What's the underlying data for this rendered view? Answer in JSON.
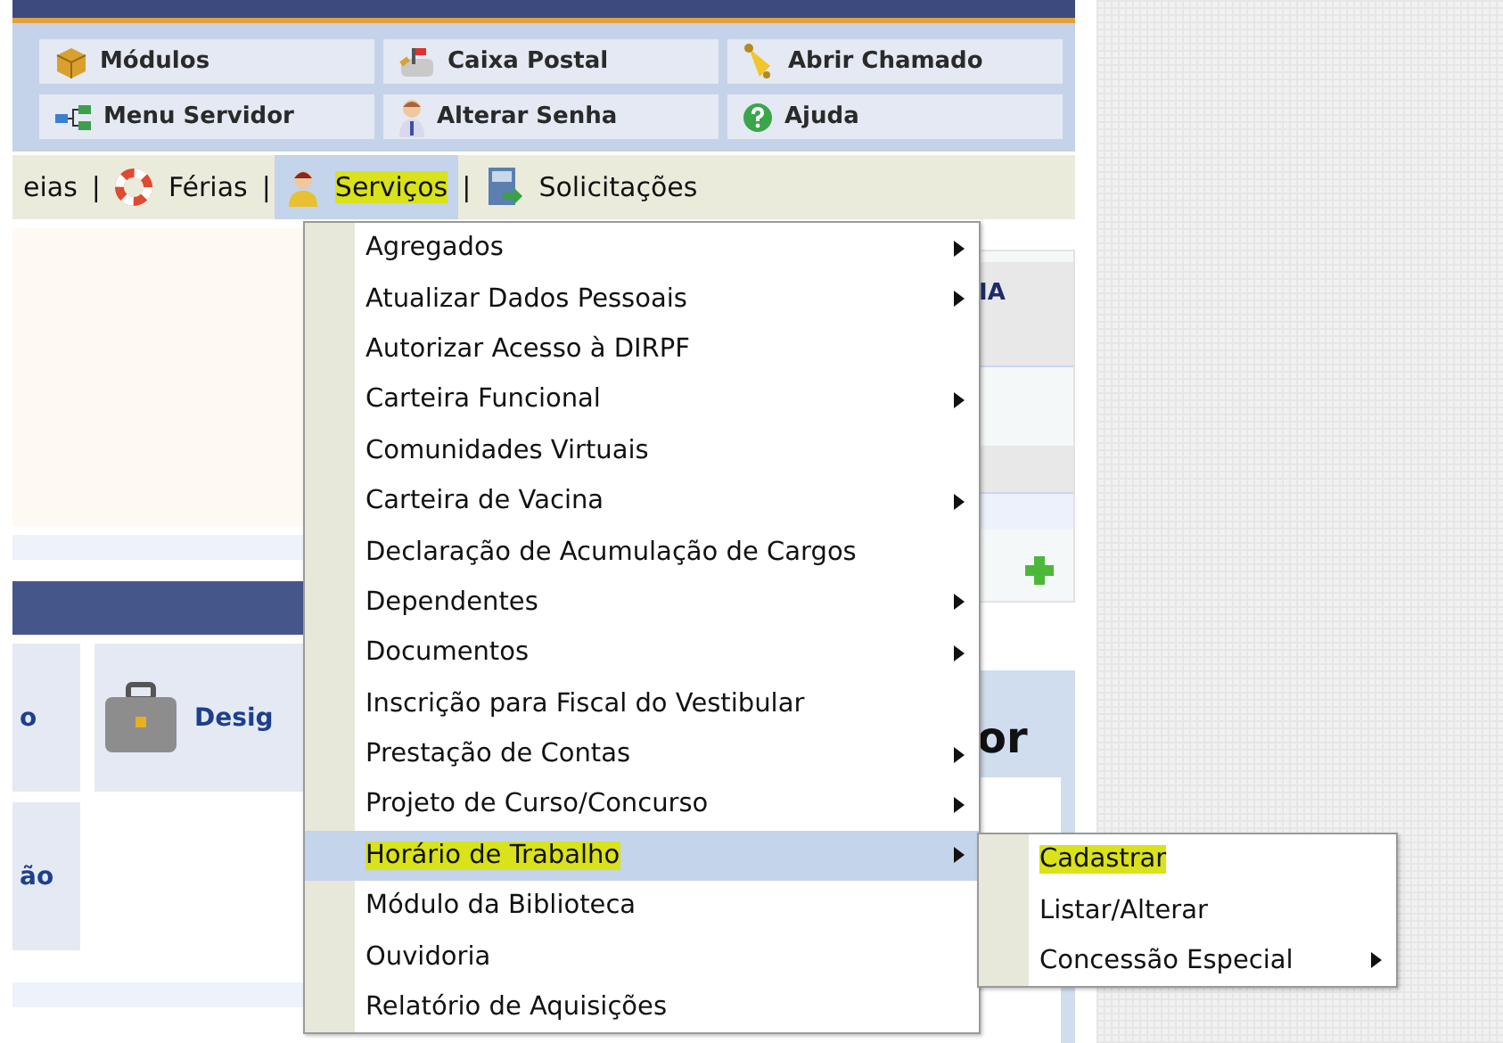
{
  "shortcuts": [
    {
      "label": "Módulos",
      "kind": "modules"
    },
    {
      "label": "Caixa Postal",
      "kind": "mail"
    },
    {
      "label": "Abrir Chamado",
      "kind": "bell"
    },
    {
      "label": "Menu Servidor",
      "kind": "tree"
    },
    {
      "label": "Alterar Senha",
      "kind": "user"
    },
    {
      "label": "Ajuda",
      "kind": "help"
    }
  ],
  "nav": {
    "separator": "|",
    "items": [
      {
        "label": "eias",
        "kind": "none",
        "selected": false,
        "highlighted": false
      },
      {
        "label": "Férias",
        "kind": "lifebuoy",
        "selected": false,
        "highlighted": false
      },
      {
        "label": "Serviços",
        "kind": "person",
        "selected": true,
        "highlighted": true
      },
      {
        "label": "Solicitações",
        "kind": "book",
        "selected": false,
        "highlighted": false
      }
    ]
  },
  "background": {
    "right_heading": "IA",
    "card_1": "o",
    "card_2": "Desig",
    "card_3": "ão",
    "panel_heading": "or"
  },
  "menu": [
    {
      "label": "Agregados",
      "submenu": true,
      "selected": false,
      "highlighted": false
    },
    {
      "label": "Atualizar Dados Pessoais",
      "submenu": true,
      "selected": false,
      "highlighted": false
    },
    {
      "label": "Autorizar Acesso à DIRPF",
      "submenu": false,
      "selected": false,
      "highlighted": false
    },
    {
      "label": "Carteira Funcional",
      "submenu": true,
      "selected": false,
      "highlighted": false
    },
    {
      "label": "Comunidades Virtuais",
      "submenu": false,
      "selected": false,
      "highlighted": false
    },
    {
      "label": "Carteira de Vacina",
      "submenu": true,
      "selected": false,
      "highlighted": false
    },
    {
      "label": "Declaração de Acumulação de Cargos",
      "submenu": false,
      "selected": false,
      "highlighted": false
    },
    {
      "label": "Dependentes",
      "submenu": true,
      "selected": false,
      "highlighted": false
    },
    {
      "label": "Documentos",
      "submenu": true,
      "selected": false,
      "highlighted": false
    },
    {
      "label": "Inscrição para Fiscal do Vestibular",
      "submenu": false,
      "selected": false,
      "highlighted": false
    },
    {
      "label": "Prestação de Contas",
      "submenu": true,
      "selected": false,
      "highlighted": false
    },
    {
      "label": "Projeto de Curso/Concurso",
      "submenu": true,
      "selected": false,
      "highlighted": false
    },
    {
      "label": "Horário de Trabalho",
      "submenu": true,
      "selected": true,
      "highlighted": true
    },
    {
      "label": "Módulo da Biblioteca",
      "submenu": false,
      "selected": false,
      "highlighted": false
    },
    {
      "label": "Ouvidoria",
      "submenu": false,
      "selected": false,
      "highlighted": false
    },
    {
      "label": "Relatório de Aquisições",
      "submenu": false,
      "selected": false,
      "highlighted": false
    }
  ],
  "submenu": [
    {
      "label": "Cadastrar",
      "submenu": false,
      "selected": false,
      "highlighted": true
    },
    {
      "label": "Listar/Alterar",
      "submenu": false,
      "selected": false,
      "highlighted": false
    },
    {
      "label": "Concessão Especial",
      "submenu": true,
      "selected": false,
      "highlighted": false
    }
  ]
}
